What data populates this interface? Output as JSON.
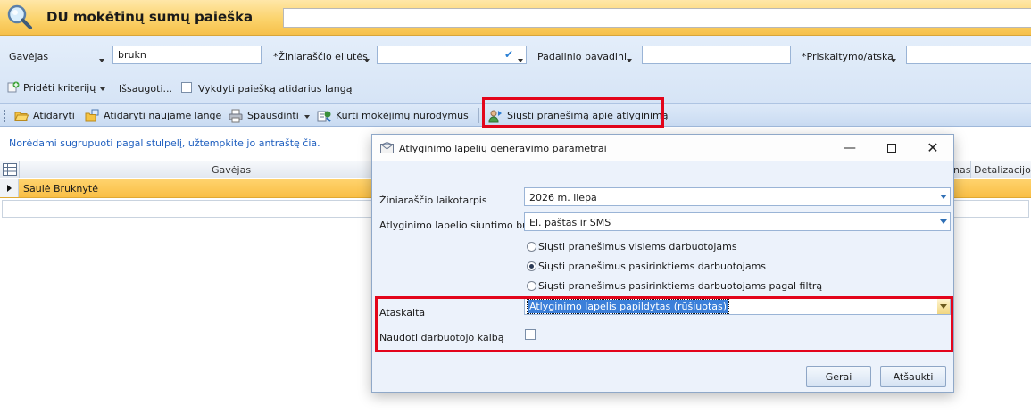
{
  "header": {
    "title": "DU mokėtinų sumų paieška",
    "icon": "magnifier-icon"
  },
  "filters": {
    "gavejas_label": "Gavėjas",
    "gavejas_value": "brukn",
    "ziniarastis_label": "*Žiniaraščio eilutės",
    "padalinio_label": "Padalinio pavadini",
    "priskaitymo_label": "*Priskaitymo/atska",
    "add_criteria": "Pridėti kriterijų",
    "save": "Išsaugoti...",
    "run_on_open": "Vykdyti paiešką atidarius langą"
  },
  "toolbar": {
    "open": "Atidaryti",
    "open_new": "Atidaryti naujame lange",
    "print": "Spausdinti",
    "payment_orders": "Kurti mokėjimų nurodymus",
    "send_notice": "Siųsti pranešimą apie atlyginimą"
  },
  "grid": {
    "group_hint": "Norėdami sugrupuoti pagal stulpelį, užtempkite jo antraštę čia.",
    "columns": [
      "Gavėjas",
      "nas",
      "Detalizacijos"
    ],
    "rows": [
      {
        "gavejas": "Saulė Bruknytė"
      }
    ]
  },
  "dialog": {
    "title": "Atlyginimo lapelių generavimo parametrai",
    "period_label": "Žiniaraščio laikotarpis",
    "period_value": "2026 m. liepa",
    "send_method_label": "Atlyginimo lapelio siuntimo būdas",
    "send_method_value": "El. paštas ir SMS",
    "radio_all": "Siųsti pranešimus visiems darbuotojams",
    "radio_selected": "Siųsti pranešimus pasirinktiems darbuotojams",
    "radio_filter": "Siųsti pranešimus pasirinktiems darbuotojams pagal filtrą",
    "report_label": "Ataskaita",
    "report_value": "Atlyginimo lapelis papildytas (rūšiuotas)",
    "language_label": "Naudoti darbuotojo kalbą",
    "ok": "Gerai",
    "cancel": "Atšaukti"
  },
  "colors": {
    "header_gold": "#fbd36c",
    "selection": "#3b7fd9",
    "highlight": "#e3051b",
    "link_blue": "#1f5fbf"
  }
}
